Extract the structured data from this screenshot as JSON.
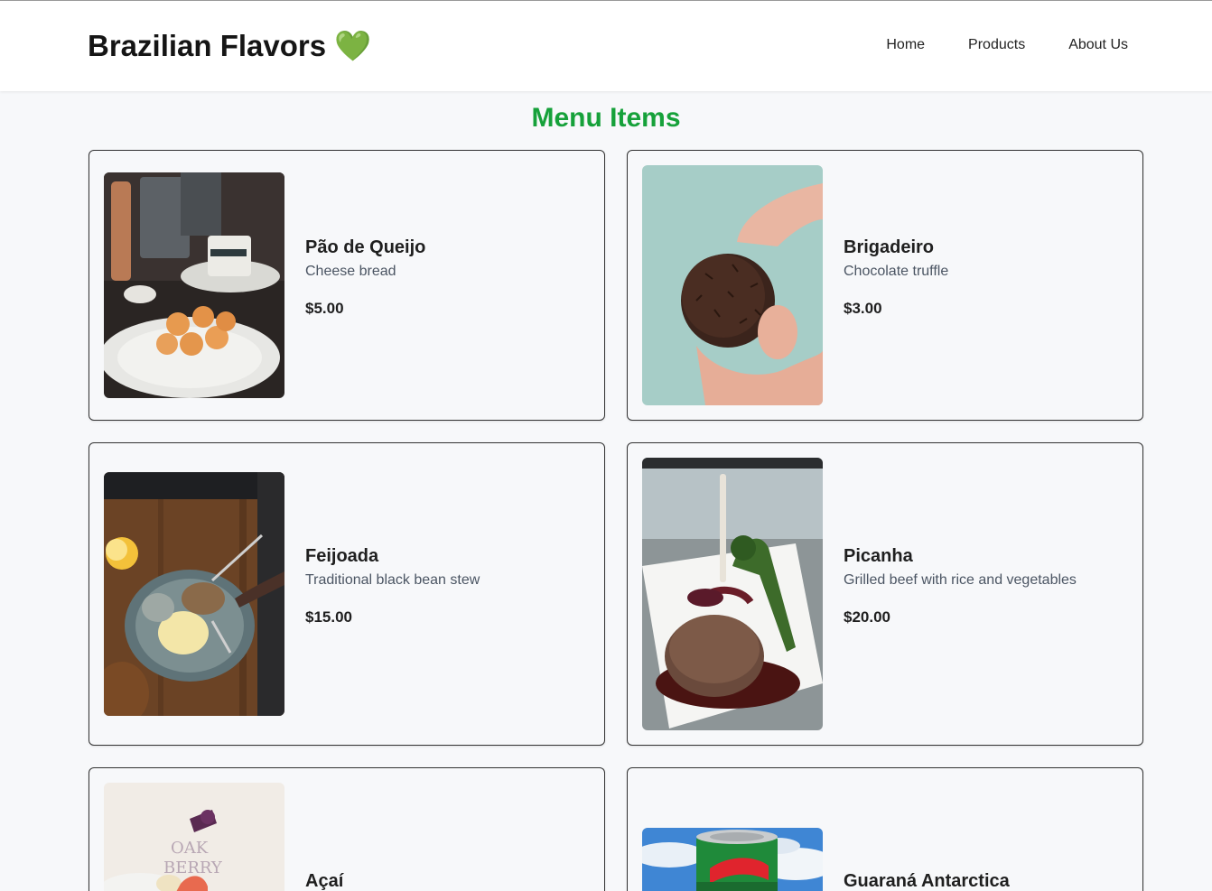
{
  "header": {
    "brand": "Brazilian Flavors",
    "brand_emoji": "💚",
    "nav": [
      "Home",
      "Products",
      "About Us"
    ]
  },
  "page_title": "Menu Items",
  "colors": {
    "accent": "#16a13a",
    "heart": "#6cc24a"
  },
  "menu": [
    {
      "name": "Pão de Queijo",
      "description": "Cheese bread",
      "price": "$5.00"
    },
    {
      "name": "Brigadeiro",
      "description": "Chocolate truffle",
      "price": "$3.00"
    },
    {
      "name": "Feijoada",
      "description": "Traditional black bean stew",
      "price": "$15.00"
    },
    {
      "name": "Picanha",
      "description": "Grilled beef with rice and vegetables",
      "price": "$20.00"
    },
    {
      "name": "Açaí"
    },
    {
      "name": "Guaraná Antarctica"
    }
  ]
}
